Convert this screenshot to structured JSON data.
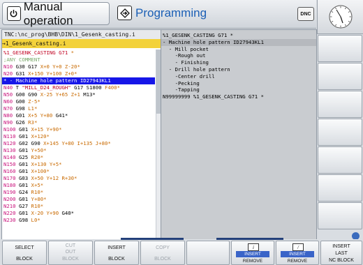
{
  "header": {
    "mode_manual": "Manual operation",
    "mode_programming": "Programming",
    "dnc_label": "DNC"
  },
  "program": {
    "path": "TNC:\\nc_prog\\BHB\\DIN\\1_Gesenk_casting.i",
    "file": "→1_Gesenk_casting.i",
    "lines": [
      {
        "segs": [
          {
            "c": "st",
            "t": "%1_GESENK_CASTING G71 "
          },
          {
            "c": "val",
            "t": "*"
          }
        ]
      },
      {
        "segs": [
          {
            "c": "cm",
            "t": ";ANY COMMENT"
          }
        ]
      },
      {
        "segs": [
          {
            "c": "ln",
            "t": "N10 "
          },
          {
            "c": "",
            "t": "G30 G17 "
          },
          {
            "c": "val",
            "t": "X+0 Y+0 Z-20*"
          }
        ]
      },
      {
        "segs": [
          {
            "c": "ln",
            "t": "N20 "
          },
          {
            "c": "",
            "t": "G31 "
          },
          {
            "c": "val",
            "t": "X+150 Y+100 Z+0*"
          }
        ]
      },
      {
        "sel": true,
        "segs": [
          {
            "c": "",
            "t": "* - Machine hole pattern ID27943KL1"
          }
        ]
      },
      {
        "segs": [
          {
            "c": "ln",
            "t": "N40 "
          },
          {
            "c": "",
            "t": "T "
          },
          {
            "c": "st",
            "t": "\"MILL_D24_ROUGH\" "
          },
          {
            "c": "",
            "t": "G17 S1800 "
          },
          {
            "c": "val",
            "t": "F400*"
          }
        ]
      },
      {
        "segs": [
          {
            "c": "ln",
            "t": "N50 "
          },
          {
            "c": "",
            "t": "G00 G90 "
          },
          {
            "c": "val",
            "t": "X-25 Y+65 Z+1 "
          },
          {
            "c": "",
            "t": "M13*"
          }
        ]
      },
      {
        "segs": [
          {
            "c": "ln",
            "t": "N60 "
          },
          {
            "c": "",
            "t": "G00 "
          },
          {
            "c": "val",
            "t": "Z-5*"
          }
        ]
      },
      {
        "segs": [
          {
            "c": "ln",
            "t": "N70 "
          },
          {
            "c": "",
            "t": "G98 "
          },
          {
            "c": "val",
            "t": "L1*"
          }
        ]
      },
      {
        "segs": [
          {
            "c": "ln",
            "t": "N80 "
          },
          {
            "c": "",
            "t": "G01 "
          },
          {
            "c": "val",
            "t": "X+5 Y+80 "
          },
          {
            "c": "",
            "t": "G41*"
          }
        ]
      },
      {
        "segs": [
          {
            "c": "ln",
            "t": "N90 "
          },
          {
            "c": "",
            "t": "G26 "
          },
          {
            "c": "val",
            "t": "R3*"
          }
        ]
      },
      {
        "segs": [
          {
            "c": "ln",
            "t": "N100 "
          },
          {
            "c": "",
            "t": "G01 "
          },
          {
            "c": "val",
            "t": "X+15 Y+90*"
          }
        ]
      },
      {
        "segs": [
          {
            "c": "ln",
            "t": "N110 "
          },
          {
            "c": "",
            "t": "G01 "
          },
          {
            "c": "val",
            "t": "X+120*"
          }
        ]
      },
      {
        "segs": [
          {
            "c": "ln",
            "t": "N120 "
          },
          {
            "c": "",
            "t": "G02 G90 "
          },
          {
            "c": "val",
            "t": "X+145 Y+80 I+135 J+80*"
          }
        ]
      },
      {
        "segs": [
          {
            "c": "ln",
            "t": "N130 "
          },
          {
            "c": "",
            "t": "G01 "
          },
          {
            "c": "val",
            "t": "Y+50*"
          }
        ]
      },
      {
        "segs": [
          {
            "c": "ln",
            "t": "N140 "
          },
          {
            "c": "",
            "t": "G25 "
          },
          {
            "c": "val",
            "t": "R20*"
          }
        ]
      },
      {
        "segs": [
          {
            "c": "ln",
            "t": "N150 "
          },
          {
            "c": "",
            "t": "G01 "
          },
          {
            "c": "val",
            "t": "X+130 Y+5*"
          }
        ]
      },
      {
        "segs": [
          {
            "c": "ln",
            "t": "N160 "
          },
          {
            "c": "",
            "t": "G01 "
          },
          {
            "c": "val",
            "t": "X+100*"
          }
        ]
      },
      {
        "segs": [
          {
            "c": "ln",
            "t": "N170 "
          },
          {
            "c": "",
            "t": "G03 "
          },
          {
            "c": "val",
            "t": "X+50 Y+12 R+30*"
          }
        ]
      },
      {
        "segs": [
          {
            "c": "ln",
            "t": "N180 "
          },
          {
            "c": "",
            "t": "G01 "
          },
          {
            "c": "val",
            "t": "X+5*"
          }
        ]
      },
      {
        "segs": [
          {
            "c": "ln",
            "t": "N190 "
          },
          {
            "c": "",
            "t": "G24 "
          },
          {
            "c": "val",
            "t": "R10*"
          }
        ]
      },
      {
        "segs": [
          {
            "c": "ln",
            "t": "N200 "
          },
          {
            "c": "",
            "t": "G01 "
          },
          {
            "c": "val",
            "t": "Y+80*"
          }
        ]
      },
      {
        "segs": [
          {
            "c": "ln",
            "t": "N210 "
          },
          {
            "c": "",
            "t": "G27 "
          },
          {
            "c": "val",
            "t": "R10*"
          }
        ]
      },
      {
        "segs": [
          {
            "c": "ln",
            "t": "N220 "
          },
          {
            "c": "",
            "t": "G01 "
          },
          {
            "c": "val",
            "t": "X-20 Y+90 "
          },
          {
            "c": "",
            "t": "G40*"
          }
        ]
      },
      {
        "segs": [
          {
            "c": "ln",
            "t": "N230 "
          },
          {
            "c": "",
            "t": "G98 "
          },
          {
            "c": "val",
            "t": "L0*"
          }
        ]
      }
    ]
  },
  "structure": {
    "lines": [
      {
        "text": "%1_GESENK_CASTING G71 *",
        "hl": false
      },
      {
        "text": "- Machine hole pattern ID27943KL1",
        "hl": true
      },
      {
        "text": "  - Mill pocket",
        "hl": false
      },
      {
        "text": "    -Rough out",
        "hl": false
      },
      {
        "text": "    - Finishing",
        "hl": false
      },
      {
        "text": "  - Drill hole pattern",
        "hl": false
      },
      {
        "text": "    -Center drill",
        "hl": false
      },
      {
        "text": "    -Pecking",
        "hl": false
      },
      {
        "text": "    -Tapping",
        "hl": false
      },
      {
        "text": "N99999999 %1_GESENK_CASTING G71 *",
        "hl": false
      }
    ]
  },
  "softkeys": {
    "select_block": {
      "line1": "SELECT",
      "line2": "BLOCK"
    },
    "cut_out_block": {
      "line1": "CUT",
      "line1b": "OUT",
      "line2": "BLOCK"
    },
    "insert_block": {
      "line1": "INSERT",
      "line2": "BLOCK"
    },
    "copy_block": {
      "line1": "COPY",
      "line2": "BLOCK"
    },
    "insert_remove_1": {
      "icon": "i",
      "mid": "INSERT",
      "bot": "REMOVE"
    },
    "insert_remove_2": {
      "icon": "/",
      "mid": "INSERT",
      "bot": "REMOVE"
    },
    "insert_last_nc_block": {
      "line1": "INSERT",
      "line1b": "LAST",
      "line2": "NC BLOCK"
    }
  },
  "colors": {
    "line_number": "#c8107a",
    "comment": "#7aa86a",
    "value": "#c96a00",
    "string": "#c00020",
    "selection": "#1616e8",
    "file_bar": "#f3d23b"
  }
}
